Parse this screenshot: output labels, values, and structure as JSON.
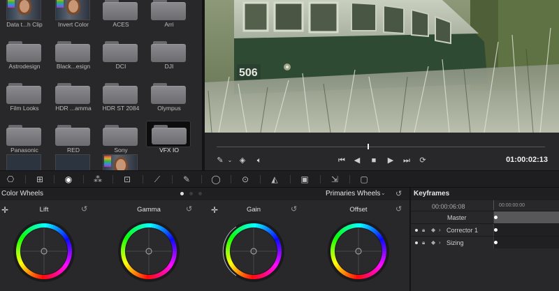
{
  "library": {
    "items": [
      {
        "label": "Data t...h Clip",
        "kind": "clip"
      },
      {
        "label": "Invert Color",
        "kind": "clip"
      },
      {
        "label": "ACES",
        "kind": "folder"
      },
      {
        "label": "Arri",
        "kind": "folder"
      },
      {
        "label": "Astrodesign",
        "kind": "folder"
      },
      {
        "label": "Black...esign",
        "kind": "folder"
      },
      {
        "label": "DCI",
        "kind": "folder"
      },
      {
        "label": "DJI",
        "kind": "folder"
      },
      {
        "label": "Film Looks",
        "kind": "folder"
      },
      {
        "label": "HDR ...amma",
        "kind": "folder"
      },
      {
        "label": "HDR ST 2084",
        "kind": "folder"
      },
      {
        "label": "Olympus",
        "kind": "folder"
      },
      {
        "label": "Panasonic",
        "kind": "folder"
      },
      {
        "label": "RED",
        "kind": "folder"
      },
      {
        "label": "Sony",
        "kind": "folder"
      },
      {
        "label": "VFX IO",
        "kind": "folder-selected"
      }
    ]
  },
  "viewer": {
    "tram_number": "506",
    "timecode": "01:00:02:13",
    "playhead_fraction": 0.46
  },
  "color_toolbar": {
    "icons": [
      "camera-raw-icon",
      "color-match-icon",
      "primaries-icon",
      "rgb-mixer-icon",
      "motion-effects-icon",
      "curves-icon",
      "qualifier-icon",
      "window-icon",
      "tracker-icon",
      "blur-icon",
      "key-icon",
      "sizing-icon",
      "3d-icon"
    ],
    "active": "primaries-icon"
  },
  "wheels": {
    "title": "Color Wheels",
    "mode": "Primaries Wheels",
    "items": [
      {
        "label": "Lift"
      },
      {
        "label": "Gamma"
      },
      {
        "label": "Gain"
      },
      {
        "label": "Offset"
      }
    ]
  },
  "keyframes": {
    "title": "Keyframes",
    "timecode": "00:00:06:08",
    "ruler_timecode": "00:00:00:00",
    "rows": [
      {
        "name": "Master"
      },
      {
        "name": "Corrector 1"
      },
      {
        "name": "Sizing"
      }
    ]
  },
  "colors": {
    "panel": "#28282b",
    "toolbar": "#1e1e20",
    "accent_active": "#ffffff"
  }
}
